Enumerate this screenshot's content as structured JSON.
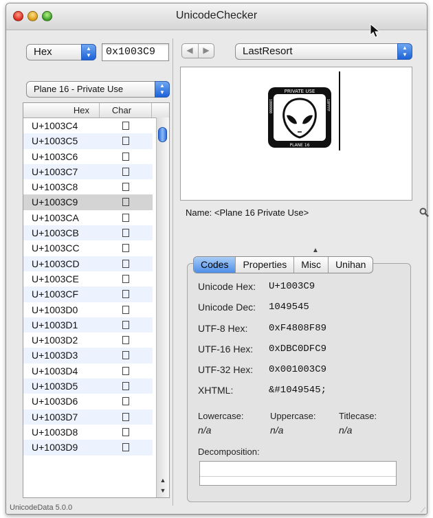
{
  "window": {
    "title": "UnicodeChecker"
  },
  "left": {
    "format_popup": "Hex",
    "code_field": "0x1003C9",
    "plane_popup": "Plane 16 - Private Use",
    "table": {
      "headers": [
        "Hex",
        "Char"
      ],
      "rows": [
        "U+1003C4",
        "U+1003C5",
        "U+1003C6",
        "U+1003C7",
        "U+1003C8",
        "U+1003C9",
        "U+1003CA",
        "U+1003CB",
        "U+1003CC",
        "U+1003CD",
        "U+1003CE",
        "U+1003CF",
        "U+1003D0",
        "U+1003D1",
        "U+1003D2",
        "U+1003D3",
        "U+1003D4",
        "U+1003D5",
        "U+1003D6",
        "U+1003D7",
        "U+1003D8",
        "U+1003D9"
      ],
      "selected": "U+1003C9"
    },
    "status": "UnicodeData 5.0.0"
  },
  "right": {
    "font_popup": "LastResort",
    "glyph": {
      "top": "PRIVATE USE",
      "bottom": "PLANE 16",
      "left": "1000000",
      "right": "10FFFF"
    },
    "name_line": "Name:  <Plane 16 Private Use>",
    "tabs": [
      "Codes",
      "Properties",
      "Misc",
      "Unihan"
    ],
    "active_tab": "Codes",
    "codes": {
      "unicode_hex_label": "Unicode Hex:",
      "unicode_hex": "U+1003C9",
      "unicode_dec_label": "Unicode Dec:",
      "unicode_dec": "1049545",
      "utf8_label": "UTF-8 Hex:",
      "utf8": "0xF4808F89",
      "utf16_label": "UTF-16 Hex:",
      "utf16": "0xDBC0DFC9",
      "utf32_label": "UTF-32 Hex:",
      "utf32": "0x001003C9",
      "xhtml_label": "XHTML:",
      "xhtml": "&#1049545;",
      "lowercase_label": "Lowercase:",
      "lowercase": "n/a",
      "uppercase_label": "Uppercase:",
      "uppercase": "n/a",
      "titlecase_label": "Titlecase:",
      "titlecase": "n/a",
      "decomposition_label": "Decomposition:"
    }
  },
  "icons": [
    "close-button",
    "minimize-button",
    "zoom-button",
    "back-arrow-icon",
    "forward-arrow-icon",
    "magnifier-icon",
    "popup-arrows-icon",
    "mouse-pointer-icon"
  ],
  "colors": {
    "selection_blue": "#4d8ee8",
    "row_alt": "#edf3fe",
    "row_selected": "#d4d4d4"
  }
}
